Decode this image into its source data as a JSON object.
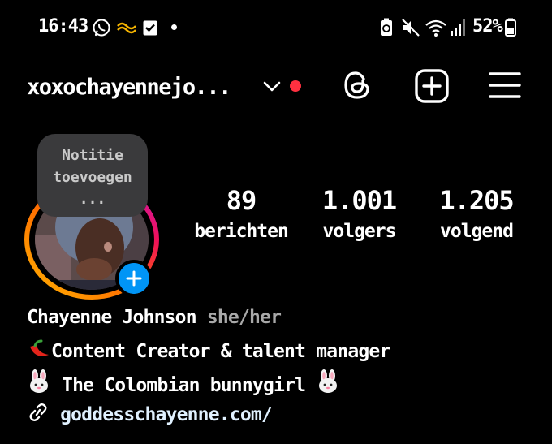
{
  "status_bar": {
    "time": "16:43",
    "battery": "52%"
  },
  "header": {
    "username": "xoxochayennejo...",
    "notification_color": "#ff3040",
    "icons": [
      "chevron-down-icon",
      "threads-icon",
      "create-post-icon",
      "menu-icon"
    ]
  },
  "profile": {
    "note_bubble": {
      "line1": "Notitie",
      "line2": "toevoegen",
      "line3": "..."
    },
    "add_story_color": "#0095f6",
    "stats": {
      "posts": {
        "value": "89",
        "label": "berichten"
      },
      "followers": {
        "value": "1.001",
        "label": "volgers"
      },
      "following": {
        "value": "1.205",
        "label": "volgend"
      }
    },
    "name": "Chayenne Johnson",
    "pronouns": "she/her",
    "bio_line1": "Content Creator & talent manager",
    "bio_line2": " The Colombian bunnygirl ",
    "link": "goddesschayenne.com/"
  }
}
